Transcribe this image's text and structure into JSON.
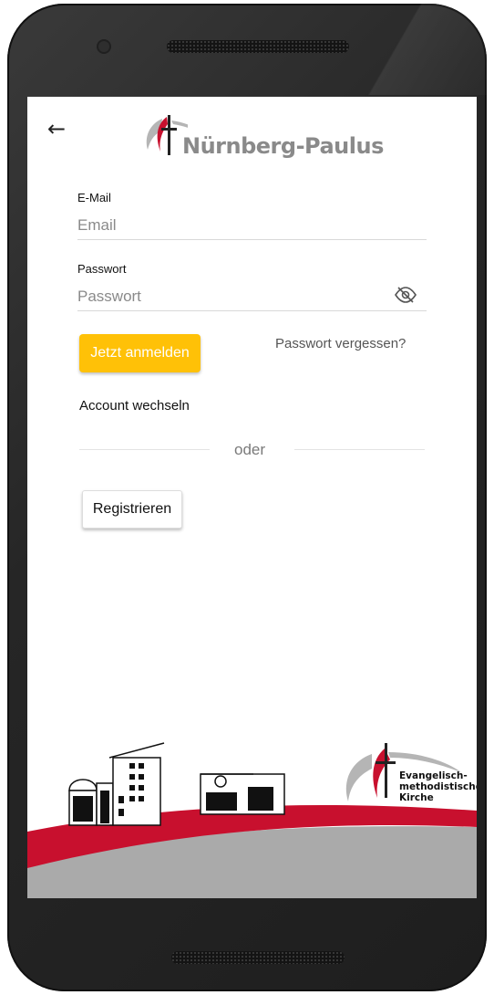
{
  "header": {
    "back_icon": "arrow-left-icon",
    "logo_text": "Nürnberg-Paulus"
  },
  "form": {
    "email_label": "E-Mail",
    "email_placeholder": "Email",
    "email_value": "",
    "password_label": "Passwort",
    "password_placeholder": "Passwort",
    "password_value": "",
    "password_toggle_icon": "eye-slash-icon",
    "login_button": "Jetzt anmelden",
    "forgot_link": "Passwort vergessen?",
    "switch_account": "Account wechseln",
    "or_divider": "oder",
    "register_button": "Registrieren"
  },
  "footer": {
    "church_name_line1": "Evangelisch-",
    "church_name_line2": "methodistische",
    "church_name_line3": "Kirche"
  },
  "colors": {
    "accent": "#ffc107",
    "brand_red": "#c8102e",
    "footer_gray": "#aaaaaa"
  }
}
